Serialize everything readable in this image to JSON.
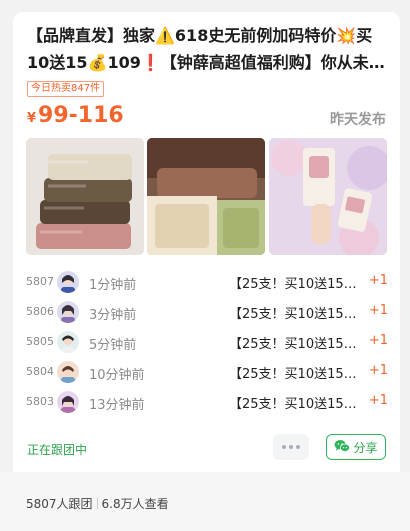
{
  "post": {
    "title": "【品牌直发】独家⚠️618史无前例加码特价💥买10送15💰109❗【钟薛高超值福利购】你从未见过的钟薛高价格",
    "hot_tag": "今日热卖847件",
    "price_currency": "¥",
    "price_range": "99-116",
    "published": "昨天发布"
  },
  "product_images": [
    {
      "alt": "stacked-ice-cream-bars"
    },
    {
      "alt": "ice-cream-bars-assortment"
    },
    {
      "alt": "hand-holding-ice-cream"
    }
  ],
  "followers": [
    {
      "num": "5807",
      "ago": "1分钟前",
      "product": "【25支！买10送15…",
      "plus": "+1"
    },
    {
      "num": "5806",
      "ago": "3分钟前",
      "product": "【25支！买10送15…",
      "plus": "+1"
    },
    {
      "num": "5805",
      "ago": "5分钟前",
      "product": "【25支！买10送15…",
      "plus": "+1"
    },
    {
      "num": "5804",
      "ago": "10分钟前",
      "product": "【25支！买10送15…",
      "plus": "+1"
    },
    {
      "num": "5803",
      "ago": "13分钟前",
      "product": "【25支！买10送15…",
      "plus": "+1"
    }
  ],
  "actions": {
    "following_label": "正在跟团中",
    "share_label": "分享"
  },
  "footer": {
    "joined": "5807人跟团",
    "views": "6.8万人查看"
  },
  "colors": {
    "accent": "#f2652d",
    "green": "#2fa24e"
  }
}
